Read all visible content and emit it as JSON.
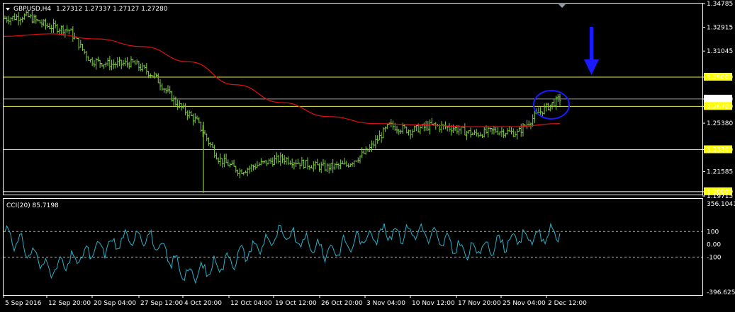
{
  "header": {
    "symbol": "GBPUSD,H4",
    "ohlc": "1.27312 1.27337 1.27127 1.27280"
  },
  "cci_header": {
    "label": "CCI(20) 85.7198"
  },
  "colors": {
    "background": "#000000",
    "frame": "#ffffff",
    "candle": "#7fce3e",
    "ma": "#e01010",
    "level": "#e8e850",
    "level_label_bg": "#ffff00",
    "price_tag_bg": "#ffffff",
    "cci": "#2ab0c8",
    "cci_level": "#b0b0b0",
    "marker": "#1a1aff"
  },
  "icons": {
    "marker": "circle-highlight",
    "arrow": "arrow-down-icon",
    "scroll": "shift-triangle-icon"
  },
  "chart_data": [
    {
      "type": "candlestick",
      "title": "GBPUSD,H4",
      "ylim": [
        1.1977,
        1.3478
      ],
      "y_ticks": [
        "1.34785",
        "1.32915",
        "1.31045",
        "1.29000",
        "1.27280",
        "1.26700",
        "1.25380",
        "1.23300",
        "1.21585",
        "1.20000",
        "1.19715"
      ],
      "x_ticks": [
        "5 Sep 2016",
        "12 Sep 20:00",
        "20 Sep 04:00",
        "27 Sep 12:00",
        "4 Oct 20:00",
        "12 Oct 04:00",
        "19 Oct 12:00",
        "26 Oct 20:00",
        "3 Nov 04:00",
        "10 Nov 12:00",
        "17 Nov 20:00",
        "25 Nov 04:00",
        "2 Dec 12:00"
      ],
      "horizontal_levels": [
        "1.29000",
        "1.26700",
        "1.23300",
        "1.20000"
      ],
      "current_price": "1.27280",
      "series": [
        {
          "kind": "close",
          "x": [
            "5 Sep 2016",
            "8 Sep",
            "12 Sep 20:00",
            "15 Sep",
            "20 Sep 04:00",
            "23 Sep",
            "27 Sep 12:00",
            "30 Sep",
            "4 Oct 20:00",
            "6 Oct",
            "7 Oct",
            "9 Oct",
            "12 Oct 04:00",
            "15 Oct",
            "19 Oct 12:00",
            "22 Oct",
            "26 Oct 20:00",
            "29 Oct",
            "3 Nov 04:00",
            "6 Nov",
            "10 Nov 12:00",
            "13 Nov",
            "17 Nov 20:00",
            "21 Nov",
            "25 Nov 04:00",
            "28 Nov",
            "2 Dec 12:00"
          ],
          "values": [
            1.336,
            1.338,
            1.33,
            1.327,
            1.303,
            1.3,
            1.301,
            1.291,
            1.27,
            1.255,
            1.226,
            1.216,
            1.222,
            1.226,
            1.222,
            1.219,
            1.221,
            1.232,
            1.252,
            1.248,
            1.252,
            1.25,
            1.245,
            1.248,
            1.246,
            1.262,
            1.273
          ]
        },
        {
          "kind": "moving_average",
          "x": [
            "5 Sep 2016",
            "12 Sep 20:00",
            "20 Sep 04:00",
            "27 Sep 12:00",
            "4 Oct 20:00",
            "12 Oct 04:00",
            "19 Oct 12:00",
            "26 Oct 20:00",
            "3 Nov 04:00",
            "10 Nov 12:00",
            "17 Nov 20:00",
            "25 Nov 04:00",
            "2 Dec 12:00"
          ],
          "values": [
            1.322,
            1.324,
            1.32,
            1.314,
            1.302,
            1.284,
            1.27,
            1.259,
            1.2535,
            1.2525,
            1.251,
            1.251,
            1.2535
          ]
        }
      ]
    },
    {
      "type": "line",
      "title": "CCI(20) 85.7198",
      "ylim": [
        -396.6258,
        356.1041
      ],
      "y_ticks": [
        "356.1041",
        "100",
        "0.00",
        "-100",
        "-396.6258"
      ],
      "levels": [
        100,
        -100
      ],
      "series": [
        {
          "kind": "cci",
          "x": [
            "5 Sep 2016",
            "12 Sep 20:00",
            "20 Sep 04:00",
            "27 Sep 12:00",
            "4 Oct 20:00",
            "12 Oct 04:00",
            "19 Oct 12:00",
            "26 Oct 20:00",
            "3 Nov 04:00",
            "10 Nov 12:00",
            "17 Nov 20:00",
            "25 Nov 04:00",
            "2 Dec 12:00"
          ],
          "values": [
            100,
            -200,
            -40,
            80,
            -250,
            -100,
            80,
            -60,
            80,
            100,
            -60,
            40,
            85.7198
          ]
        }
      ]
    }
  ]
}
